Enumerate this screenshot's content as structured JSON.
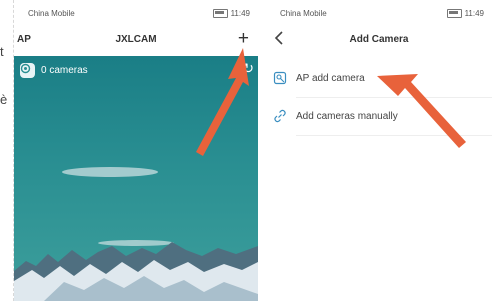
{
  "left_clip_chars": [
    "t",
    "è"
  ],
  "phone1": {
    "status": {
      "carrier": "China Mobile",
      "time": "11:49"
    },
    "header": {
      "left_label": "AP",
      "title": "JXLCAM",
      "add_icon": "plus-icon"
    },
    "camera_count": "0 cameras",
    "icons": {
      "camera": "camera-icon",
      "refresh": "refresh-icon"
    }
  },
  "phone2": {
    "status": {
      "carrier": "China Mobile",
      "time": "11:49"
    },
    "header": {
      "title": "Add Camera",
      "back_icon": "chevron-left-icon"
    },
    "menu": [
      {
        "label": "AP add camera",
        "icon": "ap-camera-icon"
      },
      {
        "label": "Add cameras manually",
        "icon": "link-icon"
      }
    ]
  },
  "colors": {
    "annotation_arrow": "#e8623b",
    "sky": "#1a7e86"
  }
}
